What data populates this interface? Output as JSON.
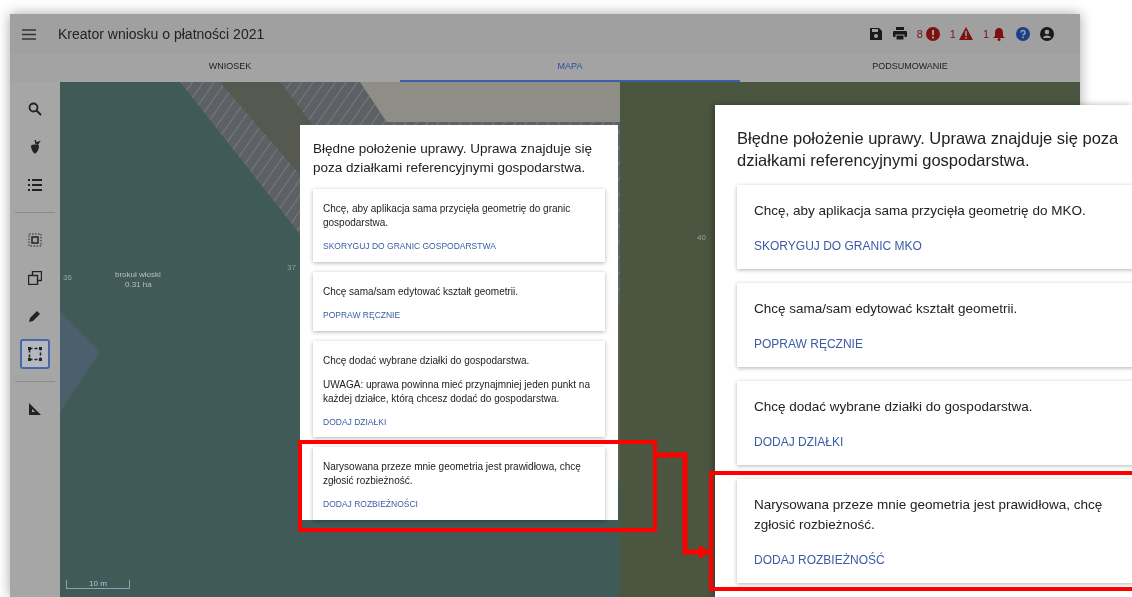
{
  "app": {
    "title": "Kreator wniosku o płatności 2021",
    "status_counts": [
      {
        "kind": "error",
        "count": "8"
      },
      {
        "kind": "warning",
        "count": "1"
      },
      {
        "kind": "notification",
        "count": "1"
      }
    ]
  },
  "tabs": [
    {
      "label": "WNIOSEK",
      "selected": false
    },
    {
      "label": "MAPA",
      "selected": true
    },
    {
      "label": "PODSUMOWANIE",
      "selected": false
    }
  ],
  "tool_groups": [
    {
      "tools": [
        {
          "kind": "search",
          "selected": false
        },
        {
          "kind": "crop",
          "selected": false
        },
        {
          "kind": "list",
          "selected": false
        }
      ]
    },
    {
      "tools": [
        {
          "kind": "select",
          "selected": false
        },
        {
          "kind": "overlap",
          "selected": false
        },
        {
          "kind": "pencil",
          "selected": false
        },
        {
          "kind": "rectangle",
          "selected": true
        }
      ]
    },
    {
      "tools": [
        {
          "kind": "measure",
          "selected": false
        }
      ]
    }
  ],
  "map_labels": [
    {
      "text": "36",
      "kind": "parcel"
    },
    {
      "text": "brokuł włoski",
      "kind": "crop"
    },
    {
      "text": "0.31 ha",
      "kind": "area"
    },
    {
      "text": "37",
      "kind": "parcel2"
    },
    {
      "text": "40",
      "kind": "parcel3"
    }
  ],
  "scale_bar": "10 m",
  "dialog": {
    "title": "Błędne położenie uprawy. Uprawa znajduje się poza działkami referencyjnymi gospodarstwa.",
    "options": [
      {
        "text": "Chcę, aby aplikacja sama przycięła geometrię do granic gospodarstwa.",
        "action": "SKORYGUJ DO GRANIC GOSPODARSTWA",
        "highlighted": false
      },
      {
        "text": "Chcę sama/sam edytować kształt geometrii.",
        "action": "POPRAW RĘCZNIE",
        "highlighted": false
      },
      {
        "text": "Chcę dodać wybrane działki do gospodarstwa.",
        "note": "UWAGA: uprawa powinna mieć przynajmniej jeden punkt na każdej działce, którą chcesz dodać do gospodarstwa.",
        "action": "DODAJ DZIAŁKI",
        "highlighted": false
      },
      {
        "text": "Narysowana przeze mnie geometria jest prawidłowa, chcę zgłosić rozbieżność.",
        "action": "DODAJ ROZBIEŻNOŚCI",
        "highlighted": true
      }
    ]
  },
  "inset": {
    "title": "Błędne położenie uprawy. Uprawa znajduje się poza działkami referencyjnymi gospodarstwa.",
    "options": [
      {
        "text": "Chcę, aby aplikacja sama przycięła geometrię do MKO.",
        "action": "SKORYGUJ DO GRANIC MKO",
        "highlighted": false
      },
      {
        "text": "Chcę sama/sam edytować kształt geometrii.",
        "action": "POPRAW RĘCZNIE",
        "highlighted": false
      },
      {
        "text": "Chcę dodać wybrane działki do gospodarstwa.",
        "action": "DODAJ DZIAŁKI",
        "highlighted": false
      },
      {
        "text": "Narysowana przeze mnie geometria jest prawidłowa, chcę zgłosić rozbieżność.",
        "action": "DODAJ ROZBIEŻNOŚĆ",
        "highlighted": true
      }
    ]
  }
}
